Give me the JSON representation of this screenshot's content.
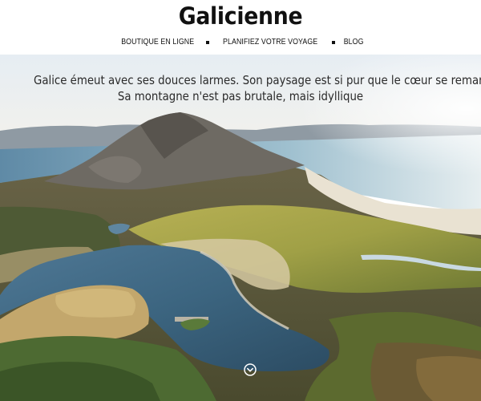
{
  "site": {
    "title": "Galicienne"
  },
  "nav": {
    "items": [
      {
        "label": "BOUTIQUE EN LIGNE"
      },
      {
        "label": "PLANIFIEZ VOTRE VOYAGE"
      },
      {
        "label": "BLOG"
      }
    ]
  },
  "hero": {
    "tagline_line1": "Galice émeut avec ses douces larmes. Son paysage est si pur que le cœur se remanie en lui.",
    "tagline_line2": "Sa montagne n'est pas brutale, mais idyllique",
    "scroll_icon": "chevron-down-circle-icon"
  },
  "colors": {
    "text": "#111111",
    "sky": "#e9eef2",
    "sea": "#8fb6c9",
    "lagoon": "#3f6884",
    "grass": "#a9a24a",
    "mountain": "#6f6a63"
  }
}
